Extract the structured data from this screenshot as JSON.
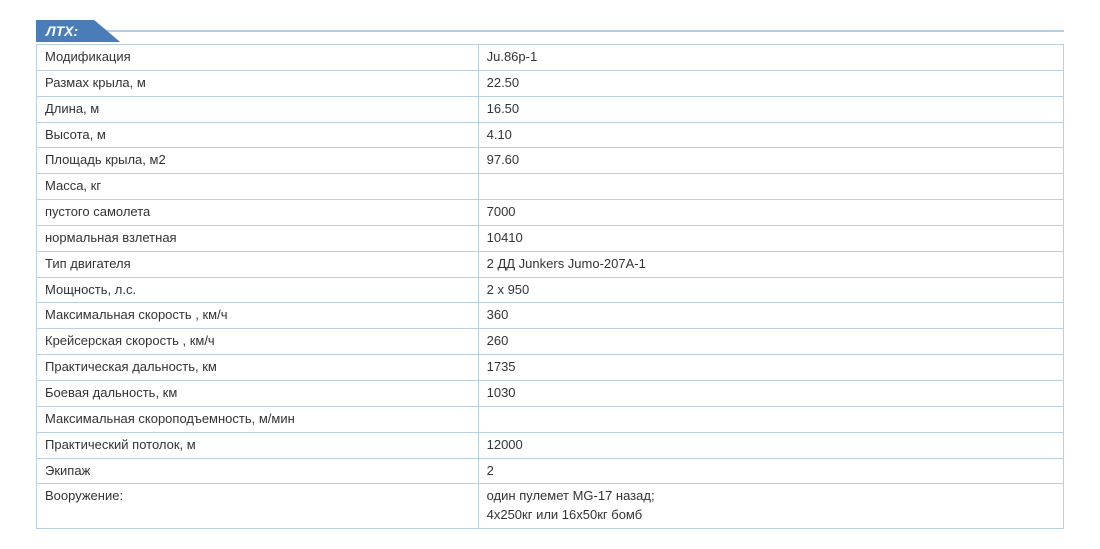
{
  "title": "ЛТХ:",
  "rows": [
    {
      "label": "Модификация",
      "value": "Ju.86p-1",
      "indent": false
    },
    {
      "label": "Размах крыла, м",
      "value": "22.50",
      "indent": false
    },
    {
      "label": "Длина, м",
      "value": "16.50",
      "indent": false
    },
    {
      "label": "Высота, м",
      "value": "4.10",
      "indent": false
    },
    {
      "label": "Площадь крыла, м2",
      "value": "97.60",
      "indent": false
    },
    {
      "label": "Масса, кг",
      "value": "",
      "indent": false
    },
    {
      "label": "пустого самолета",
      "value": "7000",
      "indent": true
    },
    {
      "label": "нормальная взлетная",
      "value": "10410",
      "indent": true
    },
    {
      "label": "Тип двигателя",
      "value": "2 ДД Junkers Jumo-207A-1",
      "indent": false
    },
    {
      "label": "Мощность, л.с.",
      "value": "2 х 950",
      "indent": false
    },
    {
      "label": "Максимальная скорость , км/ч",
      "value": "360",
      "indent": false
    },
    {
      "label": "Крейсерская скорость , км/ч",
      "value": "260",
      "indent": false
    },
    {
      "label": "Практическая дальность, км",
      "value": "1735",
      "indent": false
    },
    {
      "label": "Боевая дальность, км",
      "value": "1030",
      "indent": false
    },
    {
      "label": "Максимальная скороподъемность, м/мин",
      "value": "",
      "indent": false
    },
    {
      "label": "Практический потолок, м",
      "value": "12000",
      "indent": false
    },
    {
      "label": "Экипаж",
      "value": "2",
      "indent": false
    },
    {
      "label": "Вооружение:",
      "value": "один пулемет MG-17 назад;\n4х250кг или 16х50кг бомб",
      "indent": false
    }
  ]
}
